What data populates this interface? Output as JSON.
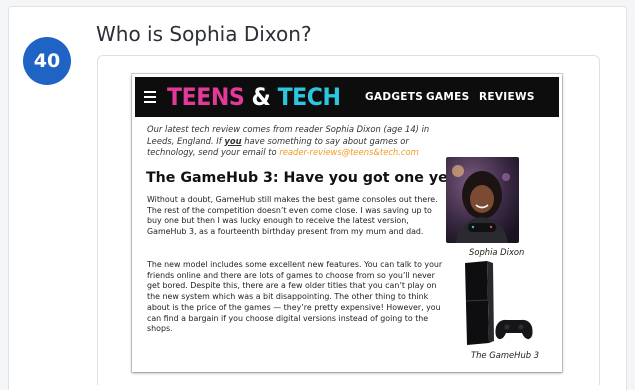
{
  "question": {
    "number": "40",
    "text": "Who is Sophia Dixon?"
  },
  "article": {
    "logo": {
      "part1": "TEENS",
      "amp": "&",
      "part2": "TECH"
    },
    "nav": [
      "GADGETS",
      "GAMES",
      "REVIEWS"
    ],
    "intro": {
      "part1": "Our latest tech review comes from  reader Sophia Dixon (age 14) in Leeds, England. If ",
      "emph": "you",
      "part2": " have something to say about games or technology, send your email to ",
      "email": "reader-reviews@teens&tech.com"
    },
    "headline": "The GameHub 3: Have you got one yet?",
    "paragraphs": [
      "Without a doubt, GameHub still makes the best game consoles out there. The rest of the competition doesn’t even come close. I was saving up to buy one but then I was lucky enough to receive the latest version, GameHub 3, as a fourteenth birthday present from my mum and dad.",
      "The new model includes some excellent new features. You can talk to your friends online and there are lots of games to choose from so you’ll never get bored. Despite this, there are a few older titles that you can’t play on the new system which was a bit disappointing. The other thing to think about is the price of the games — they’re pretty expensive! However, you can find a bargain if you choose digital versions instead of going to the shops."
    ],
    "captions": {
      "photo": "Sophia Dixon",
      "console": "The GameHub 3"
    }
  },
  "colors": {
    "badge": "#1f63c4",
    "logo_pink": "#e2399b",
    "logo_cyan": "#2cc6df",
    "email": "#f29a1d"
  }
}
